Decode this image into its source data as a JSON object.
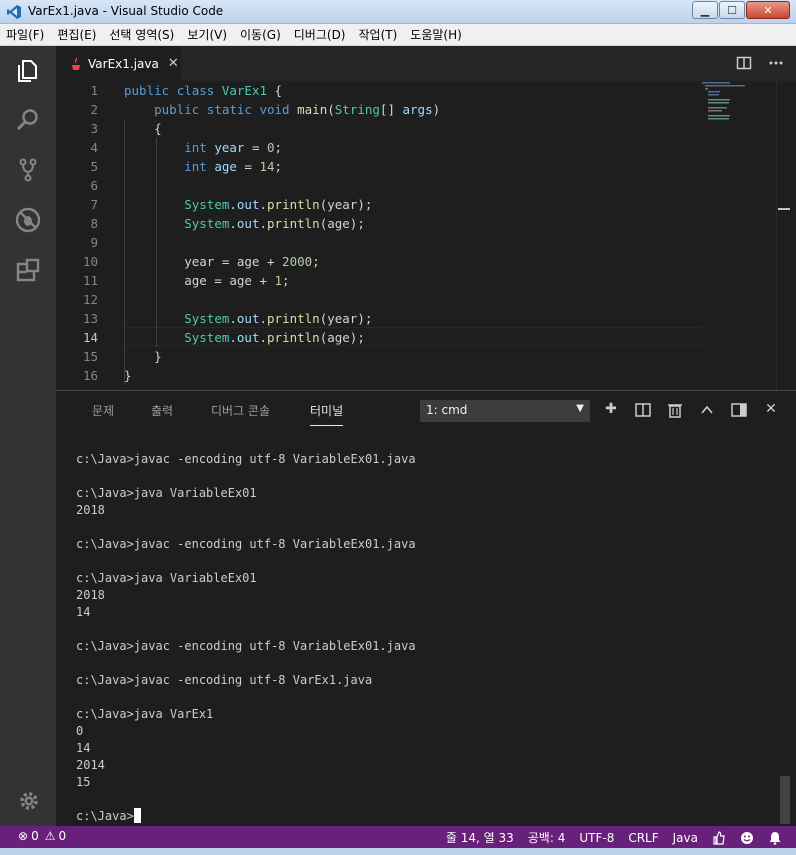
{
  "window": {
    "title": "VarEx1.java - Visual Studio Code"
  },
  "menu": [
    "파일(F)",
    "편집(E)",
    "선택 영역(S)",
    "보기(V)",
    "이동(G)",
    "디버그(D)",
    "작업(T)",
    "도움말(H)"
  ],
  "tab": {
    "label": "VarEx1.java",
    "close": "✕"
  },
  "editor": {
    "line_numbers": [
      "1",
      "2",
      "3",
      "4",
      "5",
      "6",
      "7",
      "8",
      "9",
      "10",
      "11",
      "12",
      "13",
      "14",
      "15",
      "16"
    ],
    "active_line": "14"
  },
  "panel": {
    "tabs": [
      "문제",
      "출력",
      "디버그 콘솔",
      "터미널"
    ],
    "active_tab": "터미널",
    "terminal_select": "1: cmd",
    "terminal_lines": [
      "c:\\Java>javac -encoding utf-8 VariableEx01.java",
      "",
      "c:\\Java>java VariableEx01",
      "2018",
      "",
      "c:\\Java>javac -encoding utf-8 VariableEx01.java",
      "",
      "c:\\Java>java VariableEx01",
      "2018",
      "14",
      "",
      "c:\\Java>javac -encoding utf-8 VariableEx01.java",
      "",
      "c:\\Java>javac -encoding utf-8 VarEx1.java",
      "",
      "c:\\Java>java VarEx1",
      "0",
      "14",
      "2014",
      "15",
      ""
    ],
    "prompt": "c:\\Java>"
  },
  "status": {
    "errors": "0",
    "warnings": "0",
    "position": "줄 14, 열 33",
    "spaces": "공백: 4",
    "encoding": "UTF-8",
    "eol": "CRLF",
    "language": "Java"
  },
  "colors": {
    "status_bg": "#68217a",
    "editor_bg": "#1e1e1e",
    "activity_bg": "#333333"
  }
}
